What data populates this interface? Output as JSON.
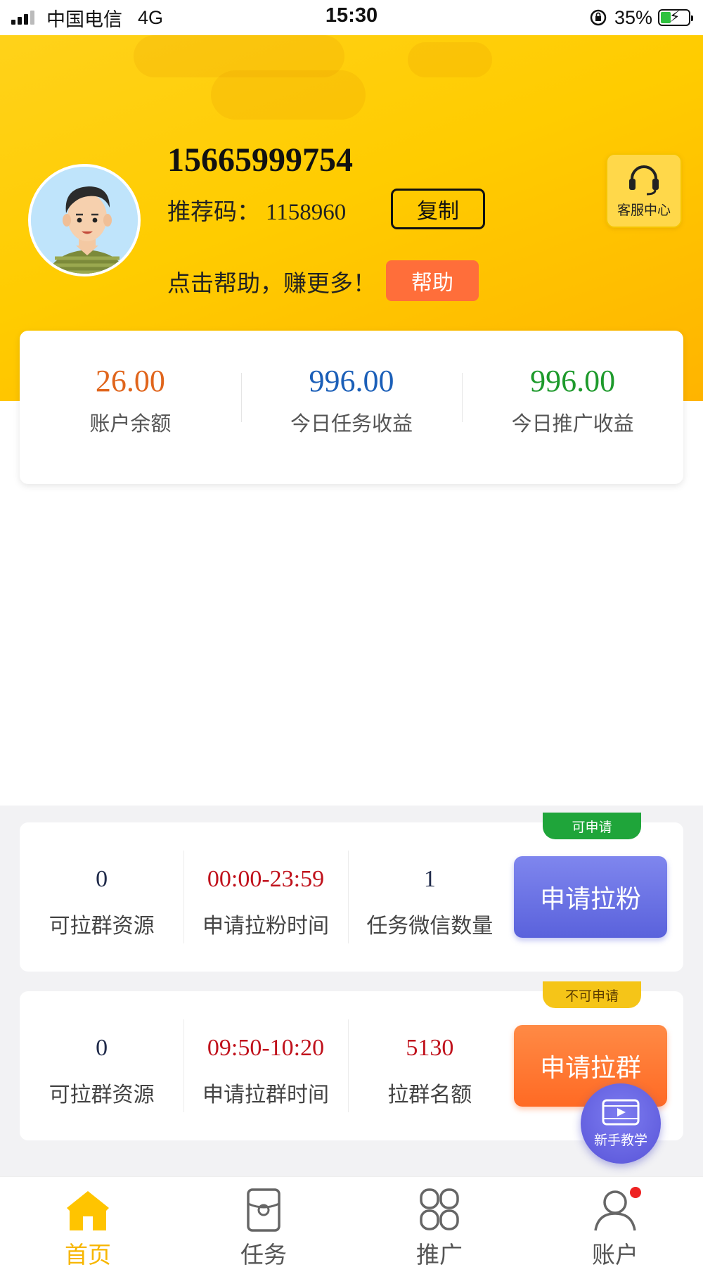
{
  "status_bar": {
    "carrier": "中国电信",
    "network": "4G",
    "time": "15:30",
    "battery": "35%"
  },
  "profile": {
    "phone": "15665999754",
    "ref_label": "推荐码：",
    "ref_code": "1158960",
    "copy_label": "复制",
    "help_text": "点击帮助，赚更多！",
    "help_label": "帮助",
    "service_label": "客服中心"
  },
  "stats": [
    {
      "value": "26.00",
      "label": "账户余额",
      "color": "#e0651c"
    },
    {
      "value": "996.00",
      "label": "今日任务收益",
      "color": "#1b5fb8"
    },
    {
      "value": "996.00",
      "label": "今日推广收益",
      "color": "#1e9a2c"
    }
  ],
  "tasks": [
    {
      "cells": [
        {
          "value": "0",
          "label": "可拉群资源",
          "color": "#1f2a4a"
        },
        {
          "value": "00:00-23:59",
          "label": "申请拉粉时间",
          "color": "#c0121c"
        },
        {
          "value": "1",
          "label": "任务微信数量",
          "color": "#1f2a4a"
        }
      ],
      "button": "申请拉粉",
      "badge": "可申请",
      "button_color": "#6b72e6",
      "badge_color": "#1fa53a"
    },
    {
      "cells": [
        {
          "value": "0",
          "label": "可拉群资源",
          "color": "#1f2a4a"
        },
        {
          "value": "09:50-10:20",
          "label": "申请拉群时间",
          "color": "#c0121c"
        },
        {
          "value": "5130",
          "label": "拉群名额",
          "color": "#c0121c"
        }
      ],
      "button": "申请拉群",
      "badge": "不可申请",
      "button_color": "#ff7a33",
      "badge_color": "#f5c518"
    }
  ],
  "float_button": "新手教学",
  "tabs": [
    {
      "label": "首页",
      "icon": "home-icon",
      "active": true
    },
    {
      "label": "任务",
      "icon": "task-icon",
      "active": false
    },
    {
      "label": "推广",
      "icon": "promote-icon",
      "active": false
    },
    {
      "label": "账户",
      "icon": "user-icon",
      "active": false
    }
  ]
}
